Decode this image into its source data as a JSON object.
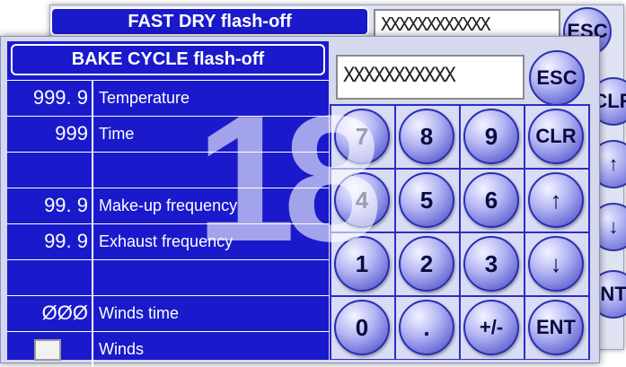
{
  "back_panel": {
    "title": "FAST DRY flash-off",
    "display_value": "XXXXXXXXXXXX",
    "keys": [
      "ESC",
      "CLR",
      "↑",
      "↓",
      "NT"
    ]
  },
  "front_panel": {
    "title": "BAKE CYCLE flash-off",
    "rows": [
      {
        "value": "999. 9",
        "label": "Temperature"
      },
      {
        "value": "999",
        "label": "Time"
      },
      {
        "value": "",
        "label": ""
      },
      {
        "value": "99. 9",
        "label": "Make-up frequency"
      },
      {
        "value": "99. 9",
        "label": "Exhaust frequency"
      },
      {
        "value": "",
        "label": ""
      },
      {
        "value": "ØØØ",
        "label": "Winds time"
      },
      {
        "value": "",
        "label": "Winds"
      }
    ],
    "winds_checked": false
  },
  "keypad": {
    "display_value": "XXXXXXXXXXX",
    "esc_label": "ESC",
    "keys": [
      "7",
      "8",
      "9",
      "CLR",
      "4",
      "5",
      "6",
      "↑",
      "1",
      "2",
      "3",
      "↓",
      "0",
      ".",
      "+/-",
      "ENT"
    ]
  },
  "watermark": "18",
  "colors": {
    "panel_blue": "#1a1acc",
    "key_blue": "#6468d4",
    "background": "#d6d9ee"
  }
}
